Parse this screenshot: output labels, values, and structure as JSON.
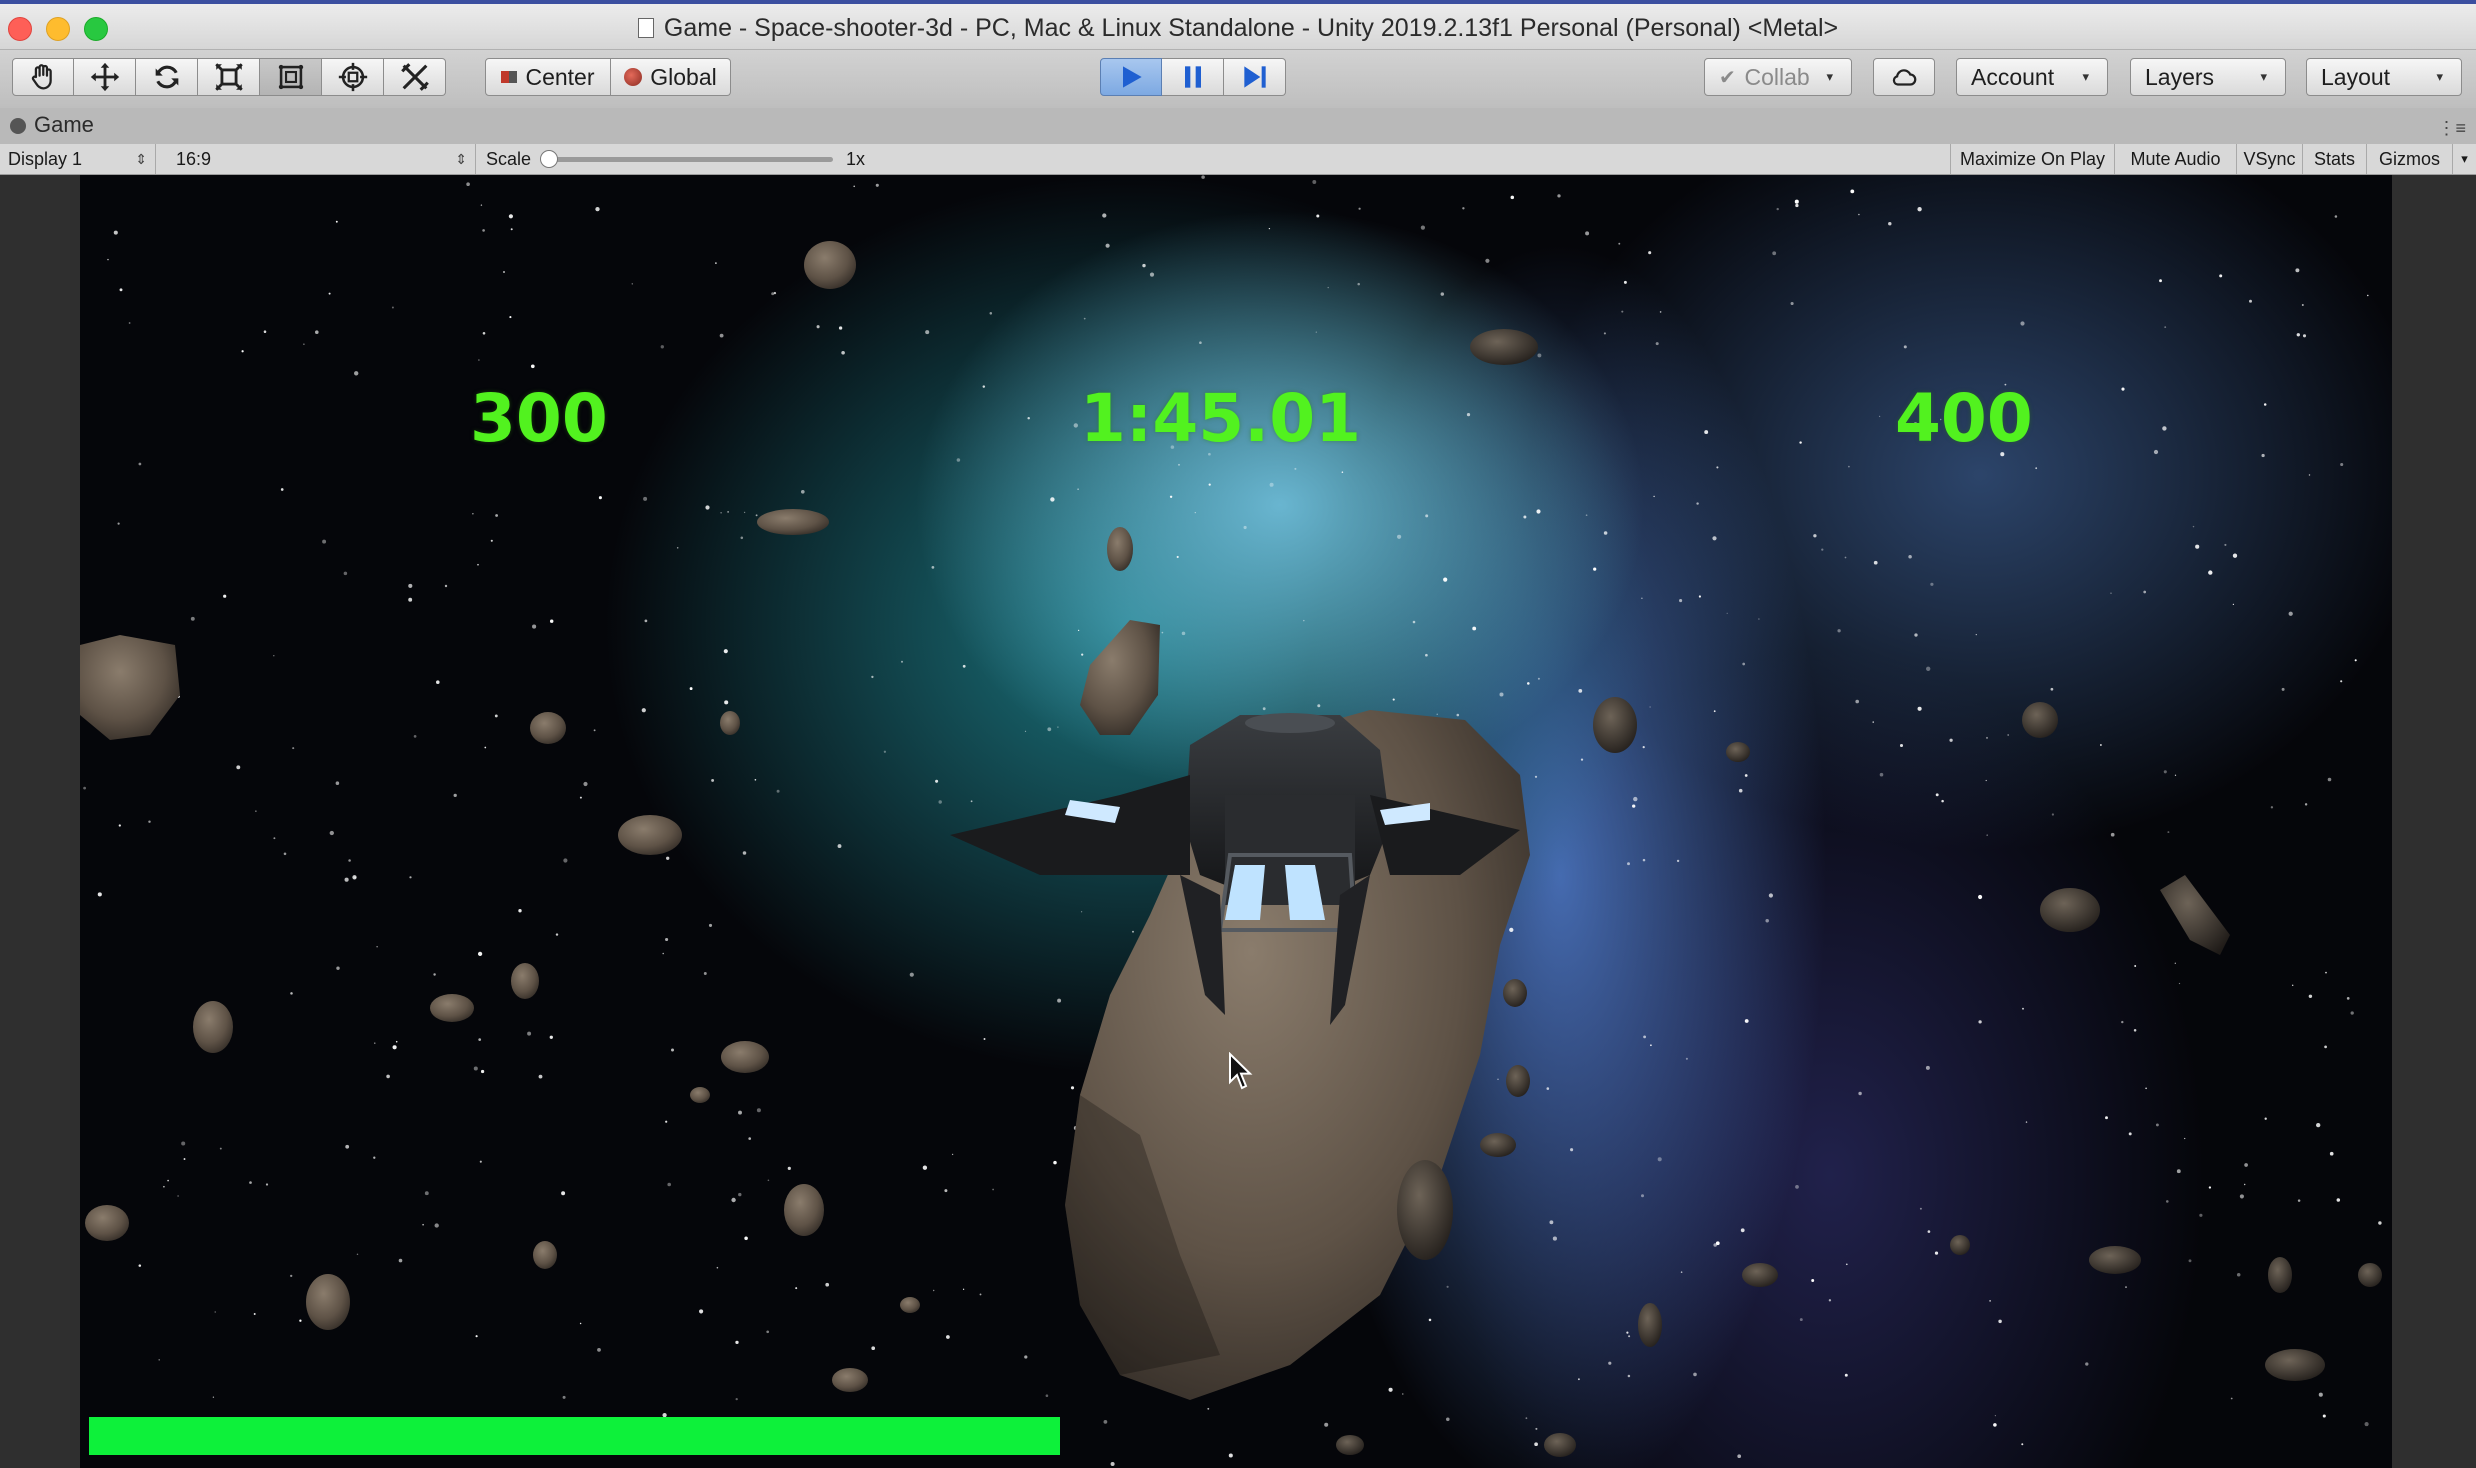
{
  "window": {
    "title": "Game - Space-shooter-3d - PC, Mac & Linux Standalone - Unity 2019.2.13f1 Personal (Personal) <Metal>"
  },
  "toolbar": {
    "tools": [
      "hand-tool-icon",
      "move-tool-icon",
      "rotate-tool-icon",
      "scale-tool-icon",
      "rect-tool-icon",
      "transform-tool-icon",
      "custom-tool-icon"
    ],
    "active_tool": "rect-tool",
    "pivot_mode": "Center",
    "pivot_rotation": "Global",
    "play_state": "playing",
    "collab_label": "Collab",
    "account_label": "Account",
    "layers_label": "Layers",
    "layout_label": "Layout"
  },
  "tab": {
    "label": "Game"
  },
  "game_bar": {
    "display": "Display 1",
    "aspect": "16:9",
    "scale_label": "Scale",
    "scale_value": "1x",
    "maximize_on_play": "Maximize On Play",
    "mute_audio": "Mute Audio",
    "vsync": "VSync",
    "stats": "Stats",
    "gizmos": "Gizmos"
  },
  "game": {
    "score_left": "300",
    "timer": "1:45.01",
    "score_right": "400",
    "health_fraction": 0.42,
    "colors": {
      "hud_text": "#52f21f",
      "health_bar": "#0df13a"
    }
  }
}
